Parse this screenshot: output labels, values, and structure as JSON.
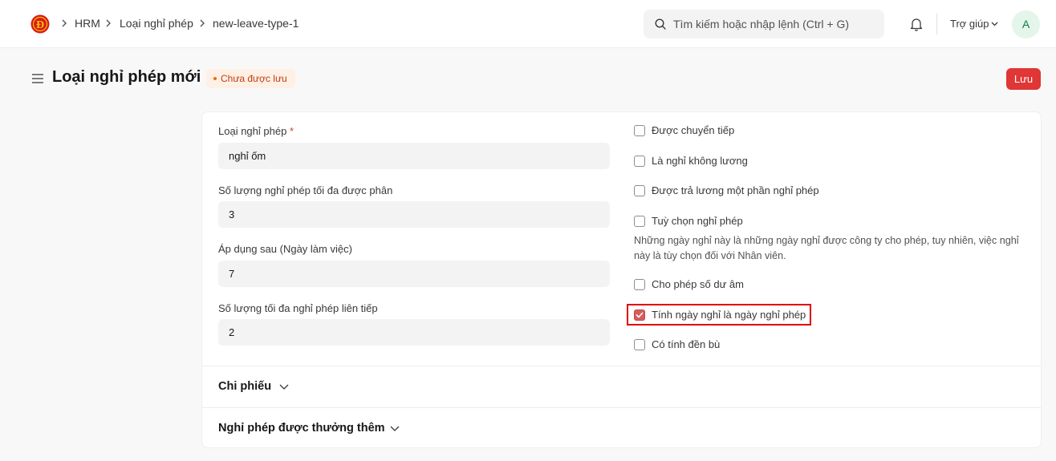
{
  "breadcrumbs": [
    "HRM",
    "Loại nghỉ phép",
    "new-leave-type-1"
  ],
  "search": {
    "placeholder": "Tìm kiếm hoặc nhập lệnh (Ctrl + G)"
  },
  "navbar": {
    "help_label": "Trợ giúp",
    "avatar_initial": "A"
  },
  "page": {
    "title": "Loại nghỉ phép mới",
    "status": "Chưa được lưu",
    "save_label": "Lưu"
  },
  "form": {
    "fields": [
      {
        "label": "Loại nghỉ phép",
        "required": "*",
        "value": "nghỉ ốm"
      },
      {
        "label": "Số lượng nghỉ phép tối đa được phân",
        "value": "3"
      },
      {
        "label": "Áp dụng sau (Ngày làm việc)",
        "value": "7"
      },
      {
        "label": "Số lượng tối đa nghỉ phép liên tiếp",
        "value": "2"
      }
    ],
    "checks": [
      {
        "label": "Được chuyển tiếp",
        "checked": false
      },
      {
        "label": "Là nghỉ không lương",
        "checked": false
      },
      {
        "label": "Được trả lương một phần nghỉ phép",
        "checked": false
      },
      {
        "label": "Tuỳ chọn nghỉ phép",
        "checked": false
      },
      {
        "label": "Cho phép số dư âm",
        "checked": false
      },
      {
        "label": "Tính ngày nghỉ là ngày nghỉ phép",
        "checked": true
      },
      {
        "label": "Có tính đền bù",
        "checked": false
      }
    ],
    "optional_help_line1": "Những ngày nghỉ này là những ngày nghỉ được công ty cho phép, tuy nhiên, việc nghỉ",
    "optional_help_line2": "này là tùy chọn đối với Nhân viên."
  },
  "sections": [
    "Chi phiếu",
    "Nghỉ phép được thưởng thêm"
  ],
  "colors": {
    "primary": "#e03636",
    "status_bg": "#fff0e6",
    "status_text": "#bd3e0c",
    "highlight": "#e00000"
  }
}
